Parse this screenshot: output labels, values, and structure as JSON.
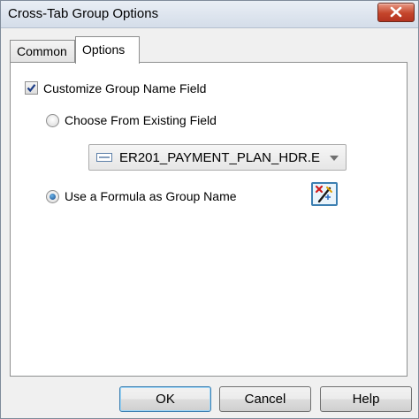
{
  "window": {
    "title": "Cross-Tab Group Options"
  },
  "tabs": [
    {
      "label": "Common",
      "selected": false
    },
    {
      "label": "Options",
      "selected": true
    }
  ],
  "options": {
    "customize_label": "Customize Group Name Field",
    "customize_checked": true,
    "choose_existing_label": "Choose From Existing Field",
    "choose_existing_selected": false,
    "existing_field_value": "ER201_PAYMENT_PLAN_HDR.E",
    "use_formula_label": "Use a Formula as Group Name",
    "use_formula_selected": true
  },
  "buttons": {
    "ok": "OK",
    "cancel": "Cancel",
    "help": "Help"
  },
  "colors": {
    "accent": "#3c7fb1",
    "close": "#c4452b"
  },
  "icons": {
    "close": "close-icon",
    "field": "database-field-icon",
    "dropdown": "chevron-down-icon",
    "formula": "formula-editor-icon"
  }
}
